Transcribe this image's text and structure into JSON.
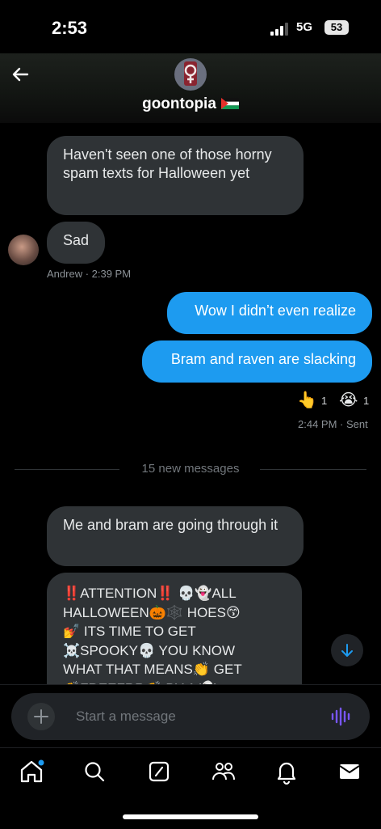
{
  "status": {
    "time": "2:53",
    "network": "5G",
    "battery": "53"
  },
  "header": {
    "title": "goontopia"
  },
  "messages": [
    {
      "id": "m1",
      "direction": "incoming",
      "text": "Haven't seen one of those horny spam texts for Halloween yet"
    },
    {
      "id": "m2",
      "direction": "incoming",
      "text": "Sad",
      "sender": "Andrew",
      "time": "2:39 PM"
    },
    {
      "id": "m3",
      "direction": "outgoing",
      "text": "Wow I didn’t even realize"
    },
    {
      "id": "m4",
      "direction": "outgoing",
      "text": "Bram and raven are slacking",
      "reactions": [
        {
          "emoji": "👆",
          "count": "1"
        },
        {
          "emoji": "😭",
          "count": "1"
        }
      ],
      "time": "2:44 PM",
      "status": "Sent"
    },
    {
      "id": "m5",
      "direction": "incoming",
      "text": "Me and bram are going through it"
    },
    {
      "id": "m6",
      "direction": "incoming",
      "lines": [
        "‼️ATTENTION‼️ 💀👻ALL",
        "HALLOWEEN🎃🕸️ HOES😙",
        "💅 ITS TIME TO GET",
        "☠️SPOOKY💀 YOU KNOW",
        "WHAT THAT MEANS👏 GET",
        "👏FREEFRR👏 BY A 👻"
      ]
    }
  ],
  "divider": {
    "text": "15 new messages"
  },
  "composer": {
    "placeholder": "Start a message"
  },
  "colors": {
    "accent": "#1d9bf0",
    "incoming_bubble": "#2f3336",
    "background": "#000000",
    "mic": "#7856ff"
  },
  "tabbar": {
    "items": [
      "home-icon",
      "search-icon",
      "grok-icon",
      "communities-icon",
      "notifications-icon",
      "messages-icon"
    ]
  }
}
